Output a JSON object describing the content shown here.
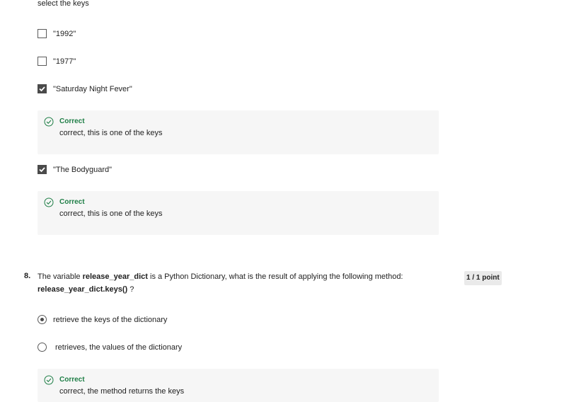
{
  "q7": {
    "instruction": "select  the keys",
    "options": [
      {
        "label": "\"1992\"",
        "checked": false
      },
      {
        "label": "\"1977\"",
        "checked": false
      },
      {
        "label": "\"Saturday Night Fever\"",
        "checked": true
      },
      {
        "label": "\"The Bodyguard\"",
        "checked": true
      }
    ],
    "feedback": [
      {
        "status": "Correct",
        "text": "correct, this is one of the keys"
      },
      {
        "status": "Correct",
        "text": "correct, this is one of the keys"
      }
    ]
  },
  "q8": {
    "number": "8.",
    "text_before": "The variable ",
    "code1": "release_year_dict",
    "text_after": " is a Python Dictionary, what is the result of applying the following method:",
    "code2": "release_year_dict.keys()",
    "text_end": " ?",
    "points": "1 / 1 point",
    "options": [
      {
        "label": "retrieve the keys of the dictionary",
        "selected": true
      },
      {
        "label": "retrieves, the values of the dictionary",
        "selected": false
      }
    ],
    "feedback": {
      "status": "Correct",
      "text": "correct, the method returns the keys"
    }
  },
  "colors": {
    "correct": "#1e7e46",
    "feedback_bg": "#f6f6f6",
    "checkbox_checked": "#4a4a4a"
  },
  "icons": {
    "correct": "check-circle-icon",
    "checkbox_checked": "checkmark-icon"
  }
}
